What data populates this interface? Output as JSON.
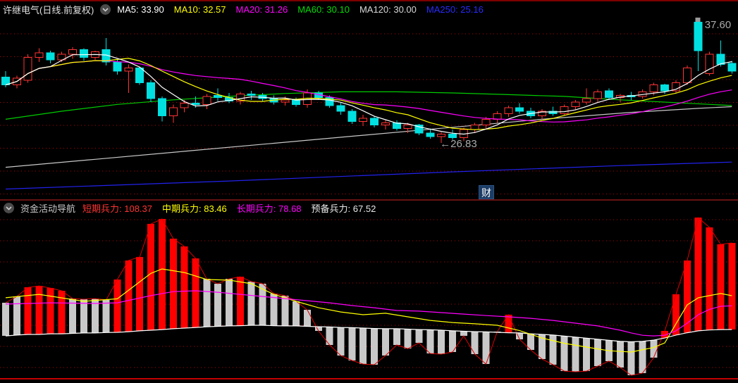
{
  "window": {
    "background": "#000000",
    "top_border_color": "#7d0000",
    "divider_color": "#671212",
    "bottom_line_color": "#c40000"
  },
  "main_chart": {
    "title": "许继电气(日线.前复权)",
    "collapse_icon": "chevron-down-circle",
    "watermark": "财",
    "legend": [
      {
        "label": "MA5",
        "value": "33.90",
        "text": "MA5: 33.90",
        "color": "#ffffff"
      },
      {
        "label": "MA10",
        "value": "32.57",
        "text": "MA10: 32.57",
        "color": "#ffff00"
      },
      {
        "label": "MA20",
        "value": "31.26",
        "text": "MA20: 31.26",
        "color": "#ff00ff"
      },
      {
        "label": "MA60",
        "value": "30.10",
        "text": "MA60: 30.10",
        "color": "#00dd00"
      },
      {
        "label": "MA120",
        "value": "30.00",
        "text": "MA120: 30.00",
        "color": "#d8d8d8"
      },
      {
        "label": "MA250",
        "value": "25.16",
        "text": "MA250: 25.16",
        "color": "#2a2aff"
      }
    ]
  },
  "sub_chart": {
    "title": "资金活动导航",
    "collapse_icon": "chevron-down-circle",
    "legend": [
      {
        "label": "短期兵力",
        "value": "108.37",
        "text": "短期兵力: 108.37",
        "color": "#ff3434"
      },
      {
        "label": "中期兵力",
        "value": "83.46",
        "text": "中期兵力: 83.46",
        "color": "#ffff00"
      },
      {
        "label": "长期兵力",
        "value": "78.68",
        "text": "长期兵力: 78.68",
        "color": "#ff00ff"
      },
      {
        "label": "预备兵力",
        "value": "67.52",
        "text": "预备兵力: 67.52",
        "color": "#e8e8e8"
      }
    ]
  },
  "chart_data": [
    {
      "type": "candlestick",
      "title": "许继电气(日线.前复权)",
      "grid": "dotted-red-horizontal",
      "ylim": [
        21.9,
        37.85
      ],
      "up_color": "#ff3434",
      "down_color": "#00e0e0",
      "annotations": {
        "high": "37.60",
        "low": "←26.83",
        "high_index": 62,
        "low_index": 39,
        "high_value": 37.6,
        "low_value": 26.83
      },
      "candles": [
        [
          32.6,
          33.1,
          31.7,
          31.9
        ],
        [
          31.9,
          32.7,
          31.6,
          32.5
        ],
        [
          32.3,
          34.6,
          32.1,
          34.3
        ],
        [
          34.3,
          35.1,
          33.9,
          34.7
        ],
        [
          34.7,
          34.9,
          33.8,
          34.1
        ],
        [
          34.1,
          34.8,
          33.9,
          34.6
        ],
        [
          34.6,
          35.2,
          34.2,
          35.0
        ],
        [
          35.0,
          35.1,
          34.0,
          34.3
        ],
        [
          34.3,
          34.9,
          34.1,
          34.8
        ],
        [
          35.0,
          36.0,
          33.6,
          33.9
        ],
        [
          33.9,
          34.1,
          32.8,
          33.1
        ],
        [
          33.1,
          33.7,
          31.2,
          33.4
        ],
        [
          33.4,
          33.5,
          31.9,
          32.1
        ],
        [
          32.1,
          32.3,
          30.4,
          30.7
        ],
        [
          30.7,
          30.9,
          28.7,
          29.2
        ],
        [
          29.2,
          30.2,
          28.6,
          29.9
        ],
        [
          29.9,
          30.6,
          29.5,
          30.3
        ],
        [
          30.3,
          30.9,
          29.9,
          30.2
        ],
        [
          30.2,
          31.1,
          29.8,
          30.9
        ],
        [
          31.0,
          31.6,
          30.5,
          30.8
        ],
        [
          30.8,
          31.2,
          30.3,
          30.5
        ],
        [
          30.5,
          31.3,
          30.2,
          31.1
        ],
        [
          31.1,
          31.4,
          30.6,
          31.0
        ],
        [
          31.0,
          31.2,
          30.5,
          30.7
        ],
        [
          30.7,
          31.0,
          30.2,
          30.4
        ],
        [
          30.4,
          30.9,
          30.1,
          30.6
        ],
        [
          30.6,
          30.8,
          30.0,
          30.2
        ],
        [
          30.2,
          31.5,
          29.9,
          31.2
        ],
        [
          31.2,
          31.4,
          30.6,
          30.8
        ],
        [
          30.8,
          31.0,
          29.9,
          30.1
        ],
        [
          30.1,
          30.4,
          29.3,
          29.6
        ],
        [
          29.6,
          29.8,
          28.5,
          28.7
        ],
        [
          28.7,
          29.3,
          28.3,
          29.0
        ],
        [
          29.0,
          29.2,
          28.2,
          28.4
        ],
        [
          28.4,
          28.9,
          28.0,
          28.6
        ],
        [
          28.6,
          28.8,
          27.9,
          28.1
        ],
        [
          28.1,
          28.6,
          27.7,
          28.4
        ],
        [
          28.4,
          28.5,
          27.5,
          27.7
        ],
        [
          27.7,
          28.1,
          27.2,
          27.4
        ],
        [
          27.4,
          27.8,
          26.83,
          27.6
        ],
        [
          27.6,
          28.0,
          27.1,
          27.3
        ],
        [
          27.3,
          28.2,
          27.0,
          28.0
        ],
        [
          28.0,
          28.6,
          27.7,
          28.4
        ],
        [
          28.4,
          29.1,
          28.1,
          28.9
        ],
        [
          28.9,
          29.6,
          28.6,
          29.4
        ],
        [
          29.4,
          30.1,
          29.1,
          29.9
        ],
        [
          29.9,
          30.3,
          29.4,
          29.6
        ],
        [
          29.6,
          29.9,
          29.0,
          29.2
        ],
        [
          29.2,
          29.8,
          28.9,
          29.6
        ],
        [
          29.6,
          30.0,
          29.2,
          29.4
        ],
        [
          29.4,
          30.2,
          29.2,
          30.0
        ],
        [
          30.0,
          30.6,
          29.7,
          30.4
        ],
        [
          30.4,
          31.6,
          30.2,
          30.7
        ],
        [
          30.7,
          31.5,
          30.4,
          31.3
        ],
        [
          31.4,
          31.6,
          30.6,
          30.8
        ],
        [
          30.8,
          31.1,
          30.4,
          31.0
        ],
        [
          31.0,
          31.3,
          30.6,
          30.9
        ],
        [
          30.9,
          31.5,
          30.7,
          31.3
        ],
        [
          31.3,
          32.1,
          31.0,
          31.9
        ],
        [
          31.9,
          32.0,
          31.1,
          31.4
        ],
        [
          31.4,
          32.3,
          31.2,
          32.1
        ],
        [
          32.1,
          33.6,
          31.9,
          33.4
        ],
        [
          37.4,
          37.6,
          33.1,
          34.9
        ],
        [
          32.9,
          34.8,
          32.7,
          34.6
        ],
        [
          34.6,
          35.8,
          33.5,
          33.7
        ],
        [
          33.8,
          34.0,
          32.9,
          33.1
        ]
      ],
      "computed_ma": {
        "ma5_color": "#ffffff",
        "ma10_color": "#ffff00",
        "ma20_color": "#ff00ff"
      },
      "overlays": {
        "ma60": {
          "color": "#00cc00",
          "points": [
            [
              0,
              28.9
            ],
            [
              5,
              29.6
            ],
            [
              10,
              30.2
            ],
            [
              15,
              30.6
            ],
            [
              20,
              30.9
            ],
            [
              25,
              31.15
            ],
            [
              30,
              31.3
            ],
            [
              35,
              31.3
            ],
            [
              40,
              31.2
            ],
            [
              45,
              31.05
            ],
            [
              50,
              30.9
            ],
            [
              55,
              30.6
            ],
            [
              60,
              30.35
            ],
            [
              65,
              30.1
            ]
          ]
        },
        "ma120": {
          "color": "#c8c8c8",
          "points": [
            [
              0,
              24.7
            ],
            [
              8,
              25.4
            ],
            [
              16,
              26.1
            ],
            [
              24,
              26.8
            ],
            [
              32,
              27.5
            ],
            [
              40,
              28.2
            ],
            [
              48,
              28.9
            ],
            [
              56,
              29.5
            ],
            [
              62,
              29.85
            ],
            [
              65,
              30.0
            ]
          ]
        },
        "ma250": {
          "color": "#2222ee",
          "points": [
            [
              0,
              22.8
            ],
            [
              20,
              23.5
            ],
            [
              40,
              24.3
            ],
            [
              55,
              24.85
            ],
            [
              65,
              25.16
            ]
          ]
        }
      }
    },
    {
      "type": "bar",
      "title": "资金活动导航",
      "grid": "dotted-red-horizontal",
      "ylim": [
        44,
        121
      ],
      "bar_up_color": "#ff0000",
      "bar_down_color": "#c8c8c8",
      "tip_line_color": "#dd0000",
      "baseline_color": "#ffffff",
      "values": {
        "short": 108.37,
        "mid": 83.46,
        "long": 78.68,
        "reserve": 67.52
      },
      "series": {
        "short_term_ends": [
          80.1,
          83.1,
          87.4,
          88.1,
          87.1,
          85.8,
          82.1,
          81.8,
          82.1,
          81.5,
          91.1,
          100.1,
          101.7,
          117.3,
          119.7,
          110.4,
          106.7,
          101.1,
          91.4,
          89.1,
          91.4,
          92.4,
          90.1,
          89.1,
          84.5,
          83.5,
          80.8,
          76.8,
          66.9,
          60.2,
          55.2,
          52.9,
          51.2,
          50.9,
          55.2,
          60.2,
          58.5,
          61.2,
          56.2,
          55.9,
          56.9,
          64.5,
          55.9,
          51.2,
          66.5,
          74.5,
          62.9,
          57.9,
          53.6,
          50.9,
          47.9,
          47.6,
          47.9,
          50.2,
          52.6,
          49.6,
          45.9,
          46.9,
          54.2,
          66.9,
          84.1,
          100.1,
          120.3,
          115.7,
          107.7,
          108.37
        ],
        "baseline": [
          64.5,
          64.9,
          65.2,
          65.2,
          65.5,
          65.5,
          65.7,
          65.9,
          65.9,
          66.1,
          66.2,
          66.5,
          66.9,
          67.2,
          67.5,
          67.9,
          68.2,
          68.5,
          68.8,
          69.0,
          69.2,
          69.3,
          69.5,
          69.5,
          69.3,
          69.2,
          69.2,
          69.0,
          68.8,
          68.7,
          68.5,
          68.4,
          68.2,
          68.0,
          67.9,
          67.9,
          67.7,
          67.5,
          67.4,
          67.2,
          66.9,
          66.7,
          66.5,
          66.4,
          66.2,
          66.0,
          65.9,
          65.5,
          65.2,
          64.9,
          64.4,
          63.9,
          63.4,
          62.9,
          62.4,
          61.9,
          61.7,
          61.9,
          62.5,
          63.5,
          64.9,
          66.0,
          66.9,
          67.3,
          67.5,
          67.52
        ],
        "bar_colors": [
          "w",
          "w",
          "r",
          "r",
          "r",
          "r",
          "w",
          "w",
          "w",
          "w",
          "r",
          "r",
          "r",
          "r",
          "r",
          "r",
          "r",
          "r",
          "w",
          "w",
          "w",
          "r",
          "w",
          "w",
          "w",
          "w",
          "w",
          "w",
          "w",
          "w",
          "w",
          "w",
          "w",
          "w",
          "w",
          "w",
          "w",
          "w",
          "w",
          "w",
          "w",
          "w",
          "w",
          "w",
          "w",
          "r",
          "w",
          "w",
          "w",
          "w",
          "w",
          "w",
          "w",
          "w",
          "w",
          "w",
          "w",
          "w",
          "w",
          "r",
          "r",
          "r",
          "r",
          "r",
          "r",
          "r"
        ],
        "mid_line": {
          "color": "#ffff00",
          "points": [
            [
              0,
              82.5
            ],
            [
              3,
              84.1
            ],
            [
              7,
              80.8
            ],
            [
              10,
              82.0
            ],
            [
              13,
              94.0
            ],
            [
              14,
              96.1
            ],
            [
              16,
              94.4
            ],
            [
              18,
              91.1
            ],
            [
              20,
              90.8
            ],
            [
              22,
              89.1
            ],
            [
              24,
              84.1
            ],
            [
              26,
              80.8
            ],
            [
              28,
              77.8
            ],
            [
              30,
              75.8
            ],
            [
              32,
              74.5
            ],
            [
              34,
              75.2
            ],
            [
              36,
              73.5
            ],
            [
              38,
              71.8
            ],
            [
              40,
              70.8
            ],
            [
              42,
              70.2
            ],
            [
              44,
              69.5
            ],
            [
              46,
              67.0
            ],
            [
              48,
              63.5
            ],
            [
              50,
              61.0
            ],
            [
              52,
              59.2
            ],
            [
              54,
              57.5
            ],
            [
              56,
              56.9
            ],
            [
              58,
              59.0
            ],
            [
              59,
              61.2
            ],
            [
              60,
              70.2
            ],
            [
              61,
              79.1
            ],
            [
              62,
              82.5
            ],
            [
              63,
              83.5
            ],
            [
              64,
              84.5
            ],
            [
              65,
              83.46
            ]
          ]
        },
        "long_line": {
          "color": "#ff00ff",
          "points": [
            [
              0,
              79.5
            ],
            [
              4,
              80.1
            ],
            [
              8,
              79.8
            ],
            [
              10,
              80.1
            ],
            [
              13,
              83.5
            ],
            [
              15,
              85.4
            ],
            [
              17,
              85.8
            ],
            [
              19,
              85.1
            ],
            [
              21,
              84.1
            ],
            [
              23,
              83.1
            ],
            [
              25,
              82.1
            ],
            [
              27,
              81.1
            ],
            [
              29,
              80.1
            ],
            [
              31,
              78.8
            ],
            [
              33,
              77.8
            ],
            [
              35,
              76.5
            ],
            [
              37,
              76.2
            ],
            [
              39,
              75.5
            ],
            [
              41,
              74.8
            ],
            [
              43,
              74.1
            ],
            [
              45,
              73.5
            ],
            [
              47,
              72.8
            ],
            [
              49,
              71.8
            ],
            [
              51,
              70.5
            ],
            [
              53,
              69.2
            ],
            [
              55,
              67.2
            ],
            [
              56,
              65.9
            ],
            [
              57,
              64.8
            ],
            [
              58,
              64.5
            ],
            [
              59,
              64.8
            ],
            [
              60,
              66.9
            ],
            [
              61,
              70.5
            ],
            [
              62,
              74.5
            ],
            [
              63,
              77.0
            ],
            [
              64,
              78.5
            ],
            [
              65,
              78.68
            ]
          ]
        }
      }
    }
  ]
}
